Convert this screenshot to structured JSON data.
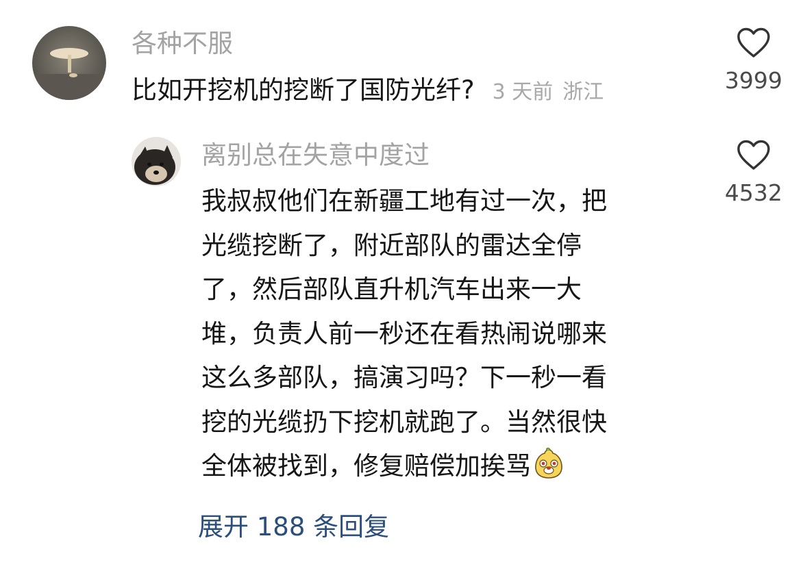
{
  "comment": {
    "username": "各种不服",
    "text": "比如开挖机的挖断了国防光纤?",
    "time": "3 天前",
    "location": "浙江",
    "likes": "3999",
    "avatar_icon": "mushroom-photo-avatar"
  },
  "reply": {
    "username": "离别总在失意中度过",
    "text": "我叔叔他们在新疆工地有过一次，把\n光缆挖断了，附近部队的雷达全停\n了，然后部队直升机汽车出来一大\n堆，负责人前一秒还在看热闹说哪来\n这么多部队，搞演习吗？下一秒一看\n挖的光缆扔下挖机就跑了。当然很快\n全体被找到，修复赔偿加挨骂",
    "likes": "4532",
    "avatar_icon": "dog-photo-avatar",
    "trailing_emoji": "grinning-mascot-emoji"
  },
  "expand_replies": {
    "label": "展开 188 条回复"
  },
  "icons": {
    "like": "heart-outline-icon"
  },
  "colors": {
    "username": "#a3a3a3",
    "meta": "#a8a8a8",
    "text": "#161616",
    "link": "#2b4f7d",
    "like_count": "#4a4a4a"
  }
}
